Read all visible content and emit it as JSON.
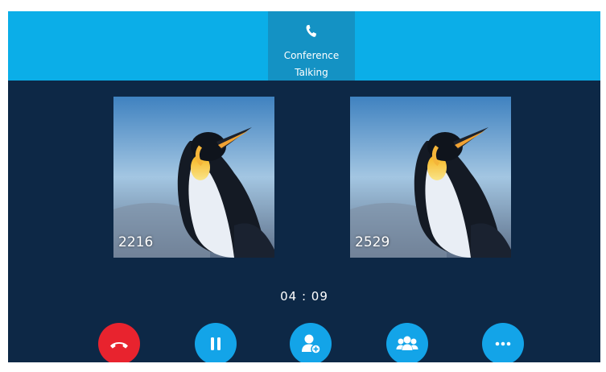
{
  "header": {
    "active_tab": {
      "icon": "phone-icon",
      "title": "Conference",
      "status": "Talking"
    },
    "colors": {
      "bar": "#0baee8",
      "active_tab": "#1492c4"
    }
  },
  "participants": [
    {
      "number": "2216",
      "avatar": "penguin-photo"
    },
    {
      "number": "2529",
      "avatar": "penguin-photo"
    }
  ],
  "call_duration": "04 : 09",
  "controls": [
    {
      "name": "end-call",
      "icon": "hang-up-icon",
      "color": "#e8232e"
    },
    {
      "name": "hold",
      "icon": "pause-icon",
      "color": "#13a4e8"
    },
    {
      "name": "add-participant",
      "icon": "add-contact-icon",
      "color": "#13a4e8"
    },
    {
      "name": "manage-conference",
      "icon": "group-icon",
      "color": "#13a4e8"
    },
    {
      "name": "more",
      "icon": "more-icon",
      "color": "#13a4e8"
    }
  ]
}
